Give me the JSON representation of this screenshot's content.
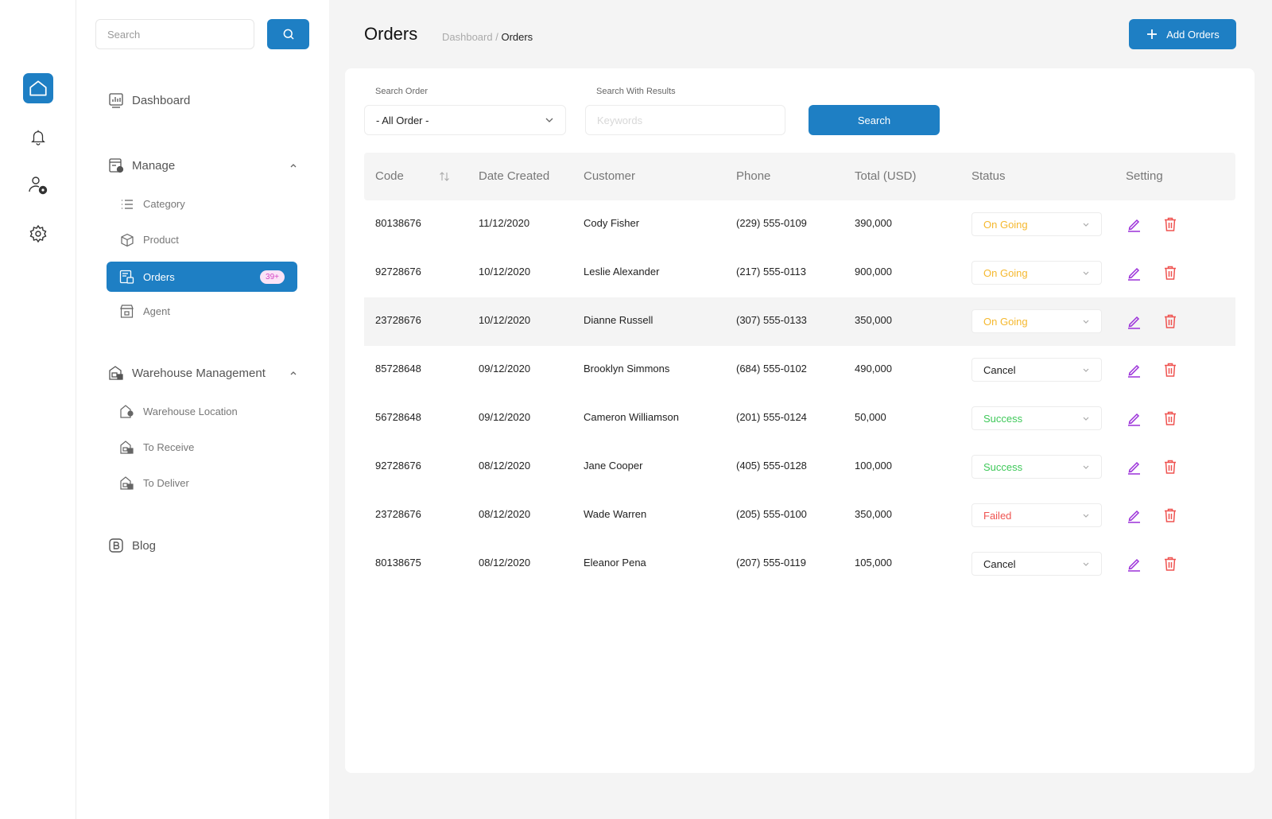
{
  "search": {
    "placeholder": "Search"
  },
  "nav": {
    "dashboard": "Dashboard",
    "manage": "Manage",
    "manage_items": [
      {
        "label": "Category"
      },
      {
        "label": "Product"
      },
      {
        "label": "Orders",
        "badge": "39+"
      },
      {
        "label": "Agent"
      }
    ],
    "warehouse": "Warehouse Management",
    "warehouse_items": [
      {
        "label": "Warehouse Location"
      },
      {
        "label": "To Receive"
      },
      {
        "label": "To Deliver"
      }
    ],
    "blog": "Blog"
  },
  "header": {
    "title": "Orders",
    "breadcrumb_parent": "Dashboard",
    "breadcrumb_sep": " / ",
    "breadcrumb_current": "Orders",
    "add_button": "Add Orders"
  },
  "filters": {
    "search_order_label": "Search Order",
    "search_order_value": "- All Order -",
    "search_results_label": "Search With Results",
    "keyword_placeholder": "Keywords",
    "search_button": "Search"
  },
  "table": {
    "columns": [
      "Code",
      "Date Created",
      "Customer",
      "Phone",
      "Total (USD)",
      "Status",
      "Setting"
    ],
    "rows": [
      {
        "code": "80138676",
        "date": "11/12/2020",
        "customer": "Cody Fisher",
        "phone": "(229) 555-0109",
        "total": "390,000",
        "status": "On Going"
      },
      {
        "code": "92728676",
        "date": "10/12/2020",
        "customer": "Leslie Alexander",
        "phone": "(217) 555-0113",
        "total": "900,000",
        "status": "On Going"
      },
      {
        "code": "23728676",
        "date": "10/12/2020",
        "customer": "Dianne Russell",
        "phone": "(307) 555-0133",
        "total": "350,000",
        "status": "On Going"
      },
      {
        "code": "85728648",
        "date": "09/12/2020",
        "customer": "Brooklyn Simmons",
        "phone": "(684) 555-0102",
        "total": "490,000",
        "status": "Cancel"
      },
      {
        "code": "56728648",
        "date": "09/12/2020",
        "customer": "Cameron Williamson",
        "phone": "(201) 555-0124",
        "total": "50,000",
        "status": "Success"
      },
      {
        "code": "92728676",
        "date": "08/12/2020",
        "customer": "Jane Cooper",
        "phone": "(405) 555-0128",
        "total": "100,000",
        "status": "Success"
      },
      {
        "code": "23728676",
        "date": "08/12/2020",
        "customer": "Wade Warren",
        "phone": "(205) 555-0100",
        "total": "350,000",
        "status": "Failed"
      },
      {
        "code": "80138675",
        "date": "08/12/2020",
        "customer": "Eleanor Pena",
        "phone": "(207) 555-0119",
        "total": "105,000",
        "status": "Cancel"
      }
    ]
  },
  "colors": {
    "primary": "#1e7fc4",
    "on_going": "#f5b82e",
    "success": "#3fc95a",
    "failed": "#ef5350",
    "cancel": "#222222",
    "edit_icon": "#9b30d9",
    "delete_icon": "#ef5350",
    "badge_text": "#d447c4"
  },
  "icons": {
    "rail": [
      "home-icon",
      "bell-icon",
      "user-settings-icon",
      "gear-icon"
    ],
    "row_actions": [
      "edit-pencil-icon",
      "trash-icon"
    ]
  }
}
